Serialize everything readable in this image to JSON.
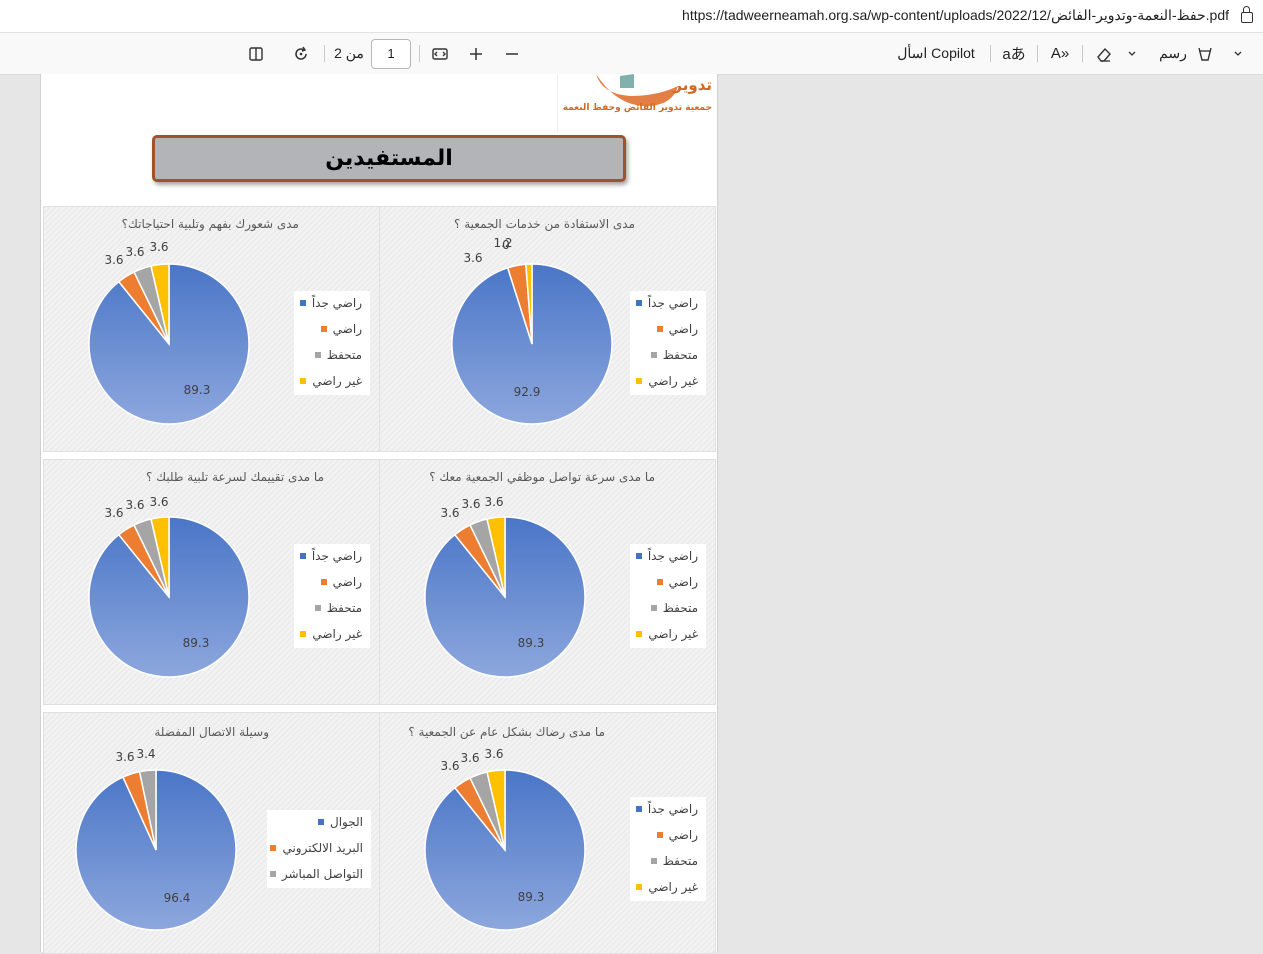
{
  "browser": {
    "url": "https://tadweerneamah.org.sa/wp-content/uploads/2022/12/حفظ-النعمة-وتدوير-الفائض.pdf"
  },
  "toolbar": {
    "page_current": "1",
    "page_of": "من 2",
    "ask_copilot": "اسأل Copilot",
    "draw_label": "رسم"
  },
  "document": {
    "logo_name": "تدوير",
    "logo_subtitle": "جمعية تدوير الفائض وحفظ النعمة",
    "section_title": "المستفيدين"
  },
  "colors": {
    "blue": "#4472c4",
    "orange": "#ed7d31",
    "gray": "#a5a5a5",
    "yellow": "#ffc000",
    "title_border": "#a0522d"
  },
  "chart_data": [
    {
      "type": "pie",
      "title": "مدى الاستفادة من خدمات الجمعية ؟",
      "categories": [
        "راضي جداً",
        "راضي",
        "متحفظ",
        "غير راضي"
      ],
      "values": [
        92.9,
        3.6,
        0,
        1.2
      ],
      "labels": [
        "92.9",
        "3.6",
        "0",
        "1.2"
      ]
    },
    {
      "type": "pie",
      "title": "مدى شعورك بفهم وتلبية احتياجاتك؟",
      "categories": [
        "راضي جداً",
        "راضي",
        "متحفظ",
        "غير راضي"
      ],
      "values": [
        89.3,
        3.6,
        3.6,
        3.6
      ],
      "labels": [
        "89.3",
        "3.6",
        "3.6",
        "3.6"
      ]
    },
    {
      "type": "pie",
      "title": "ما مدى سرعة تواصل موظفي الجمعية معك ؟",
      "categories": [
        "راضي جداً",
        "راضي",
        "متحفظ",
        "غير راضي"
      ],
      "values": [
        89.3,
        3.6,
        3.6,
        3.6
      ],
      "labels": [
        "89.3",
        "3.6",
        "3.6",
        "3.6"
      ]
    },
    {
      "type": "pie",
      "title": "ما مدى تقييمك لسرعة تلبية طلبك ؟",
      "categories": [
        "راضي جداً",
        "راضي",
        "متحفظ",
        "غير راضي"
      ],
      "values": [
        89.3,
        3.6,
        3.6,
        3.6
      ],
      "labels": [
        "89.3",
        "3.6",
        "3.6",
        "3.6"
      ]
    },
    {
      "type": "pie",
      "title": "ما مدى رضاك بشكل عام عن الجمعية ؟",
      "categories": [
        "راضي جداً",
        "راضي",
        "متحفظ",
        "غير راضي"
      ],
      "values": [
        89.3,
        3.6,
        3.6,
        3.6
      ],
      "labels": [
        "89.3",
        "3.6",
        "3.6",
        "3.6"
      ]
    },
    {
      "type": "pie",
      "title": "وسيلة الاتصال المفضلة",
      "categories": [
        "الجوال",
        "البريد الالكتروني",
        "التواصل المباشر"
      ],
      "values": [
        96.4,
        3.6,
        3.4
      ],
      "labels": [
        "96.4",
        "3.6",
        "3.4"
      ]
    }
  ]
}
